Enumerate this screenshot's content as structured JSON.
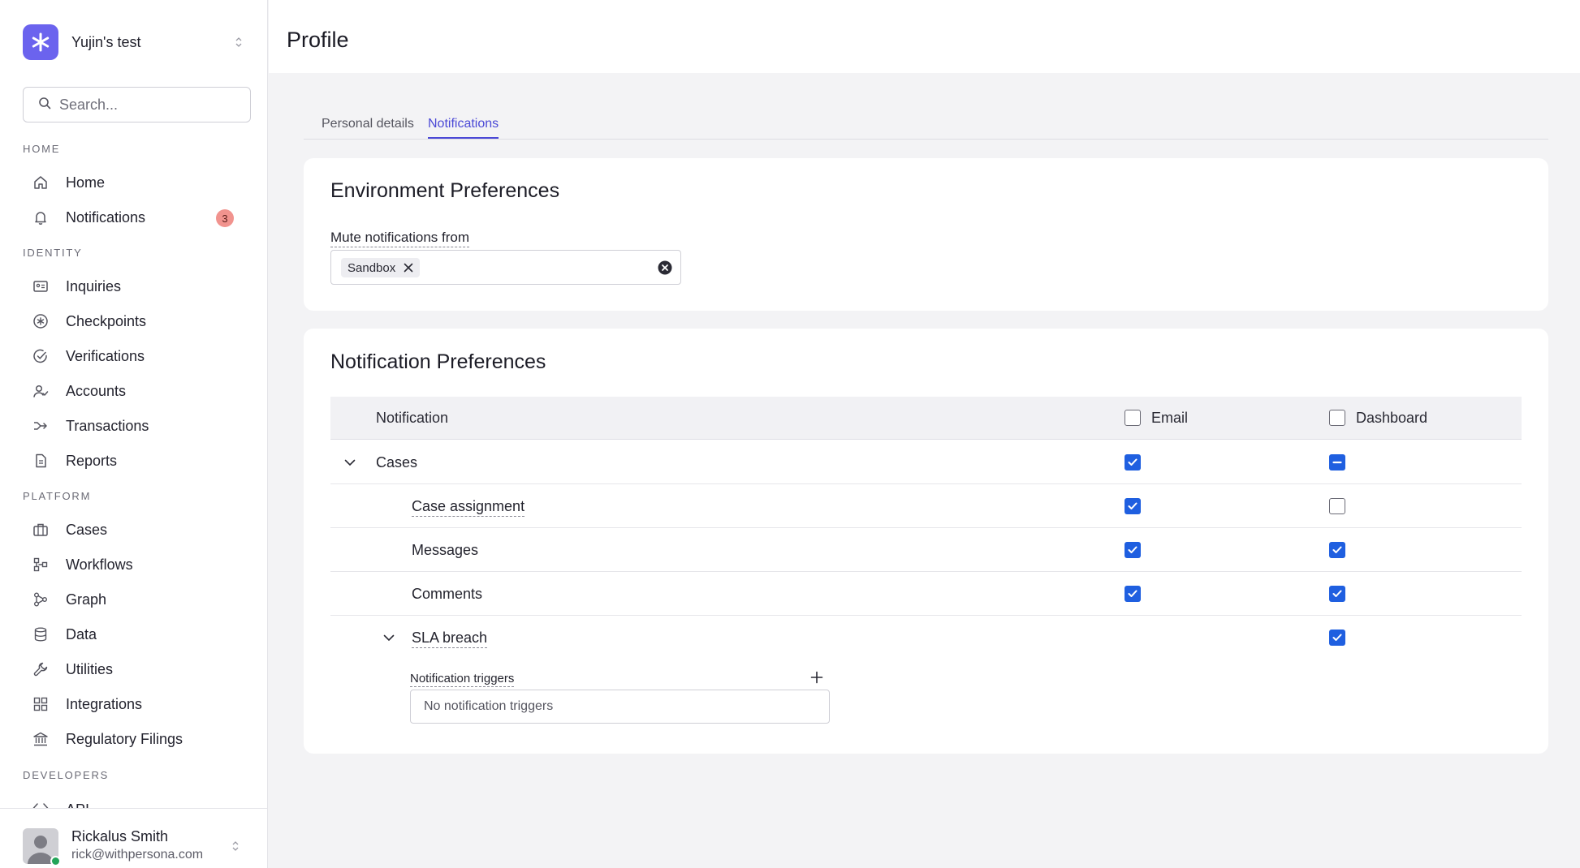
{
  "workspace": {
    "name": "Yujin's test"
  },
  "search": {
    "placeholder": "Search..."
  },
  "sidebar": {
    "sections": [
      {
        "label": "HOME"
      },
      {
        "label": "IDENTITY"
      },
      {
        "label": "PLATFORM"
      },
      {
        "label": "DEVELOPERS"
      }
    ],
    "items": [
      {
        "label": "Home",
        "icon": "home-icon"
      },
      {
        "label": "Notifications",
        "icon": "bell-icon",
        "badge": "3"
      },
      {
        "label": "Inquiries",
        "icon": "id-card-icon"
      },
      {
        "label": "Checkpoints",
        "icon": "asterisk-circle-icon"
      },
      {
        "label": "Verifications",
        "icon": "check-circle-icon"
      },
      {
        "label": "Accounts",
        "icon": "user-check-icon"
      },
      {
        "label": "Transactions",
        "icon": "arrow-split-icon"
      },
      {
        "label": "Reports",
        "icon": "document-icon"
      },
      {
        "label": "Cases",
        "icon": "briefcase-icon"
      },
      {
        "label": "Workflows",
        "icon": "workflow-icon"
      },
      {
        "label": "Graph",
        "icon": "graph-icon"
      },
      {
        "label": "Data",
        "icon": "database-icon"
      },
      {
        "label": "Utilities",
        "icon": "wrench-icon"
      },
      {
        "label": "Integrations",
        "icon": "grid-icon"
      },
      {
        "label": "Regulatory Filings",
        "icon": "bank-icon"
      },
      {
        "label": "API",
        "icon": "code-icon"
      }
    ]
  },
  "user": {
    "name": "Rickalus Smith",
    "email": "rick@withpersona.com"
  },
  "header": {
    "title": "Profile"
  },
  "tabs": [
    {
      "label": "Personal details"
    },
    {
      "label": "Notifications",
      "active": true
    }
  ],
  "environment": {
    "title": "Environment Preferences",
    "mute_label": "Mute notifications from",
    "chips": [
      "Sandbox"
    ]
  },
  "preferences": {
    "title": "Notification Preferences",
    "columns": {
      "notification": "Notification",
      "email": "Email",
      "dashboard": "Dashboard"
    },
    "rows": [
      {
        "label": "Cases",
        "email": "checked",
        "dashboard": "indeterminate"
      },
      {
        "label": "Case assignment",
        "email": "checked",
        "dashboard": "unchecked"
      },
      {
        "label": "Messages",
        "email": "checked",
        "dashboard": "checked"
      },
      {
        "label": "Comments",
        "email": "checked",
        "dashboard": "checked"
      },
      {
        "label": "SLA breach",
        "email": "none",
        "dashboard": "checked"
      }
    ],
    "triggers_label": "Notification triggers",
    "triggers_empty": "No notification triggers"
  },
  "colors": {
    "accent": "#4b49d6",
    "checkbox": "#1f5fe0",
    "brand": "#6b63ee",
    "badge": "#f1938e"
  }
}
